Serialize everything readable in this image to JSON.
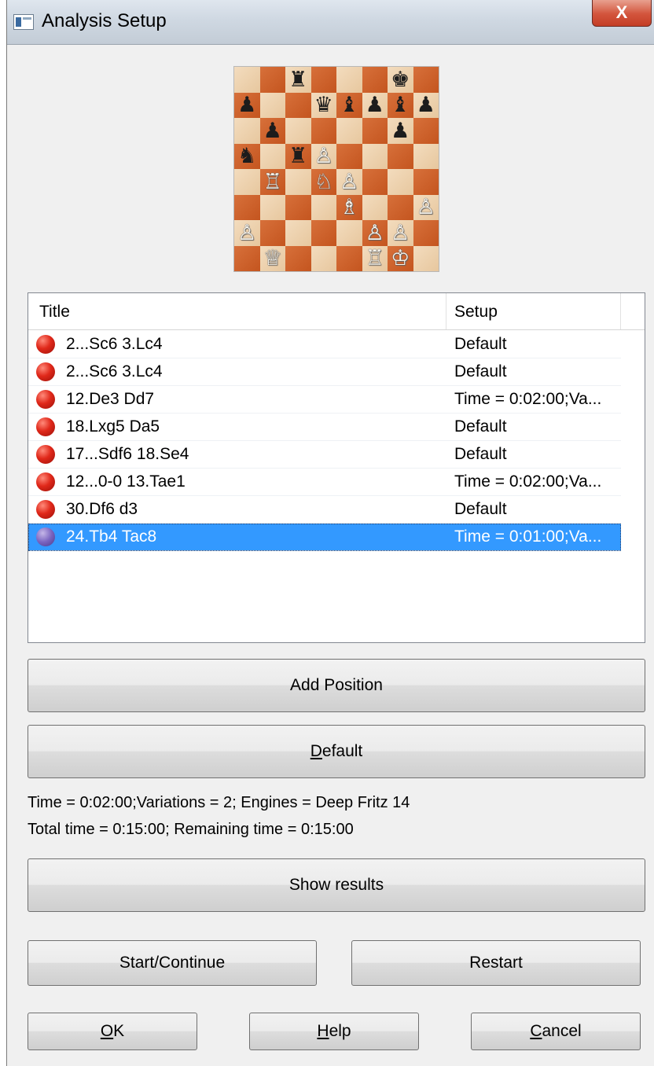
{
  "window": {
    "title": "Analysis Setup",
    "close_label": "X"
  },
  "board": {
    "rows": [
      [
        " ",
        " ",
        "♜",
        " ",
        " ",
        " ",
        "♚",
        " "
      ],
      [
        "♟",
        " ",
        " ",
        "♛",
        "♝",
        "♟",
        "♝",
        "♟"
      ],
      [
        " ",
        "♟",
        " ",
        " ",
        " ",
        " ",
        "♟",
        " "
      ],
      [
        "♞",
        " ",
        "♜",
        "♙",
        " ",
        " ",
        " ",
        " "
      ],
      [
        " ",
        "♖",
        " ",
        "♘",
        "♙",
        " ",
        " ",
        " "
      ],
      [
        " ",
        " ",
        " ",
        " ",
        "♗",
        " ",
        " ",
        "♙"
      ],
      [
        "♙",
        " ",
        " ",
        " ",
        " ",
        "♙",
        "♙",
        " "
      ],
      [
        " ",
        "♕",
        " ",
        " ",
        " ",
        "♖",
        "♔",
        " "
      ]
    ]
  },
  "list": {
    "columns": {
      "title": "Title",
      "setup": "Setup"
    },
    "rows": [
      {
        "title": "2...Sc6 3.Lc4",
        "setup": "Default",
        "selected": false
      },
      {
        "title": "2...Sc6 3.Lc4",
        "setup": "Default",
        "selected": false
      },
      {
        "title": "12.De3 Dd7",
        "setup": "Time = 0:02:00;Va...",
        "selected": false
      },
      {
        "title": "18.Lxg5 Da5",
        "setup": "Default",
        "selected": false
      },
      {
        "title": "17...Sdf6 18.Se4",
        "setup": "Default",
        "selected": false
      },
      {
        "title": "12...0-0 13.Tae1",
        "setup": "Time = 0:02:00;Va...",
        "selected": false
      },
      {
        "title": "30.Df6 d3",
        "setup": "Default",
        "selected": false
      },
      {
        "title": "24.Tb4 Tac8",
        "setup": "Time = 0:01:00;Va...",
        "selected": true
      }
    ]
  },
  "buttons": {
    "add_position": "Add Position",
    "default_accel": "D",
    "default_rest": "efault",
    "show_results": "Show results",
    "start_continue": "Start/Continue",
    "restart": "Restart",
    "ok_accel": "O",
    "ok_rest": "K",
    "help_accel": "H",
    "help_rest": "elp",
    "cancel_accel": "C",
    "cancel_rest": "ancel"
  },
  "info": {
    "setup_line": "Time = 0:02:00;Variations = 2; Engines = Deep Fritz 14",
    "time_line": "Total time = 0:15:00; Remaining time = 0:15:00"
  },
  "icons": {
    "row_status": "red-circle-icon",
    "row_status_selected": "purple-circle-icon",
    "app": "window-icon"
  },
  "colors": {
    "selection": "#3399ff",
    "status_red": "#e0281a",
    "board_light": "#f3dcbe",
    "board_dark": "#c4551f",
    "close_button": "#c33d25"
  }
}
